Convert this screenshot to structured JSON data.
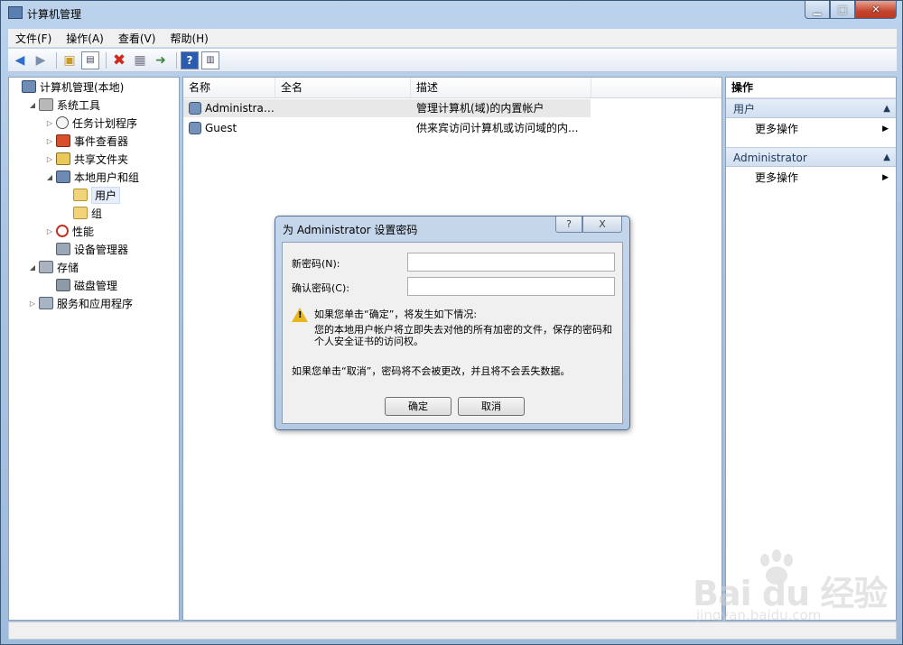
{
  "window": {
    "title": "计算机管理"
  },
  "menu": [
    "文件(F)",
    "操作(A)",
    "查看(V)",
    "帮助(H)"
  ],
  "toolbar": [
    "back-icon",
    "forward-icon",
    "up-folder-icon",
    "show-hide-tree-icon",
    "delete-icon",
    "properties-icon",
    "export-list-icon",
    "help-icon",
    "show-hide-action-pane-icon"
  ],
  "tree": [
    {
      "label": "计算机管理(本地)",
      "level": 0,
      "twisty": "",
      "icon": "computer-icon"
    },
    {
      "label": "系统工具",
      "level": 1,
      "twisty": "◢",
      "icon": "system-tools-icon"
    },
    {
      "label": "任务计划程序",
      "level": 2,
      "twisty": "▷",
      "icon": "task-scheduler-icon"
    },
    {
      "label": "事件查看器",
      "level": 2,
      "twisty": "▷",
      "icon": "event-viewer-icon"
    },
    {
      "label": "共享文件夹",
      "level": 2,
      "twisty": "▷",
      "icon": "shared-folders-icon"
    },
    {
      "label": "本地用户和组",
      "level": 2,
      "twisty": "◢",
      "icon": "local-users-groups-icon"
    },
    {
      "label": "用户",
      "level": 3,
      "twisty": "",
      "icon": "folder-icon",
      "selected": true
    },
    {
      "label": "组",
      "level": 3,
      "twisty": "",
      "icon": "folder-icon"
    },
    {
      "label": "性能",
      "level": 2,
      "twisty": "▷",
      "icon": "performance-icon"
    },
    {
      "label": "设备管理器",
      "level": 2,
      "twisty": "",
      "icon": "device-manager-icon"
    },
    {
      "label": "存储",
      "level": 1,
      "twisty": "◢",
      "icon": "storage-icon"
    },
    {
      "label": "磁盘管理",
      "level": 2,
      "twisty": "",
      "icon": "disk-management-icon"
    },
    {
      "label": "服务和应用程序",
      "level": 1,
      "twisty": "▷",
      "icon": "services-apps-icon"
    }
  ],
  "list": {
    "columns": [
      "名称",
      "全名",
      "描述"
    ],
    "rows": [
      {
        "name": "Administrat...",
        "fullname": "",
        "description": "管理计算机(域)的内置帐户",
        "icon": "user-icon"
      },
      {
        "name": "Guest",
        "fullname": "",
        "description": "供来宾访问计算机或访问域的内...",
        "icon": "user-icon"
      }
    ]
  },
  "actions": {
    "title": "操作",
    "sections": [
      {
        "header": "用户",
        "items": [
          "更多操作"
        ]
      },
      {
        "header": "Administrator",
        "items": [
          "更多操作"
        ]
      }
    ]
  },
  "dialog": {
    "title": "为 Administrator 设置密码",
    "new_password_label": "新密码(N):",
    "new_password_value": "",
    "confirm_password_label": "确认密码(C):",
    "confirm_password_value": "",
    "warning_heading": "如果您单击“确定”，将发生如下情况:",
    "warning_body": "您的本地用户帐户将立即失去对他的所有加密的文件，保存的密码和个人安全证书的访问权。",
    "cancel_note": "如果您单击“取消”，密码将不会被更改，并且将不会丢失数据。",
    "ok_label": "确定",
    "cancel_label": "取消",
    "help_glyph": "?",
    "close_glyph": "X"
  },
  "watermark": {
    "main": "Bai du 经验",
    "sub": "jingyan.baidu.com"
  },
  "colors": {
    "selection": "#e5eef9",
    "section_header": "#d2dff0",
    "warning": "#e8b71d"
  }
}
